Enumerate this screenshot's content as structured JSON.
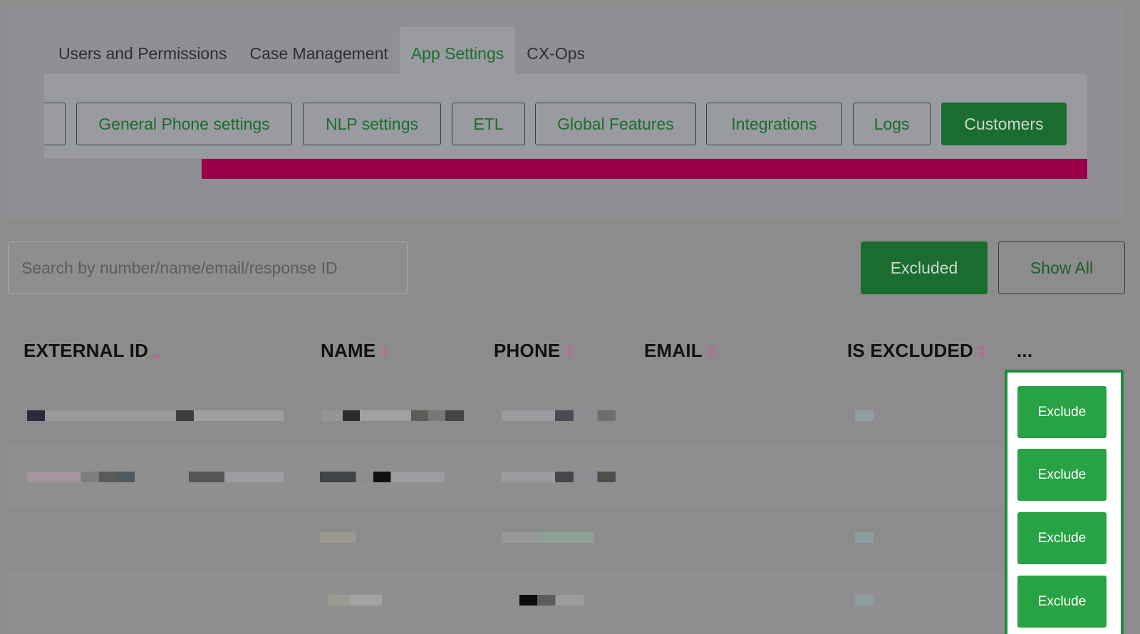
{
  "main_tabs": [
    {
      "label": "Users and Permissions",
      "active": false
    },
    {
      "label": "Case Management",
      "active": false
    },
    {
      "label": "App Settings",
      "active": true
    },
    {
      "label": "CX-Ops",
      "active": false
    }
  ],
  "sub_tabs": [
    {
      "label": "General Phone settings",
      "active": false
    },
    {
      "label": "NLP settings",
      "active": false
    },
    {
      "label": "ETL",
      "active": false
    },
    {
      "label": "Global Features",
      "active": false
    },
    {
      "label": "Integrations",
      "active": false
    },
    {
      "label": "Logs",
      "active": false
    },
    {
      "label": "Customers",
      "active": true
    }
  ],
  "search": {
    "placeholder": "Search by number/name/email/response ID"
  },
  "filters": {
    "excluded_label": "Excluded",
    "show_all_label": "Show All"
  },
  "table": {
    "columns": [
      {
        "label": "EXTERNAL ID",
        "sort": "desc"
      },
      {
        "label": "NAME",
        "sort": "both"
      },
      {
        "label": "PHONE",
        "sort": "both"
      },
      {
        "label": "EMAIL",
        "sort": "both"
      },
      {
        "label": "IS EXCLUDED",
        "sort": "both"
      },
      {
        "label": "..."
      }
    ],
    "row_action_labels": [
      "Exclude",
      "Exclude",
      "Exclude",
      "Exclude"
    ]
  },
  "colors": {
    "accent_green": "#1a6d2e",
    "exclude_green": "#27a244",
    "highlight_border": "#1f8a3c",
    "banner_magenta": "#9a0048"
  }
}
